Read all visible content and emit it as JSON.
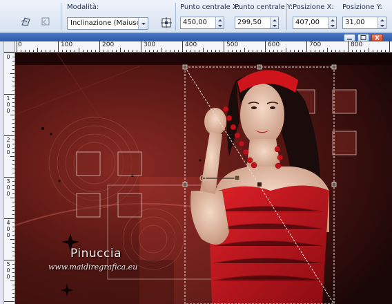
{
  "toolbar": {
    "tools": [
      {
        "name": "deform-tool-icon"
      },
      {
        "name": "reset-deform-icon"
      }
    ],
    "mode_label": "Modalità:",
    "mode_value": "Inclinazione (Maiusc)",
    "center_x_label": "Punto centrale X:",
    "center_x_value": "450,00",
    "center_y_label": "Punto centrale Y:",
    "center_y_value": "299,50",
    "pos_x_label": "Posizione X:",
    "pos_x_value": "407,00",
    "pos_y_label": "Posizione Y:",
    "pos_y_value": "31,00",
    "center_tool_icon": "target-center-icon"
  },
  "window": {
    "title": "",
    "accent": "#2d5aa8"
  },
  "ruler": {
    "h_labels": [
      "100",
      "200",
      "300",
      "400",
      "500",
      "600",
      "700",
      "800"
    ],
    "v_labels": [
      "0",
      "100",
      "200",
      "300",
      "400",
      "500",
      "600"
    ]
  },
  "canvas": {
    "watermark_name": "Pinuccia",
    "watermark_url": "www.maidiregrafica.eu",
    "colors": {
      "background": "#2a0c0c",
      "dress": "#c4141c",
      "headband": "#d0141c",
      "selection": "#e8e2d8"
    }
  }
}
